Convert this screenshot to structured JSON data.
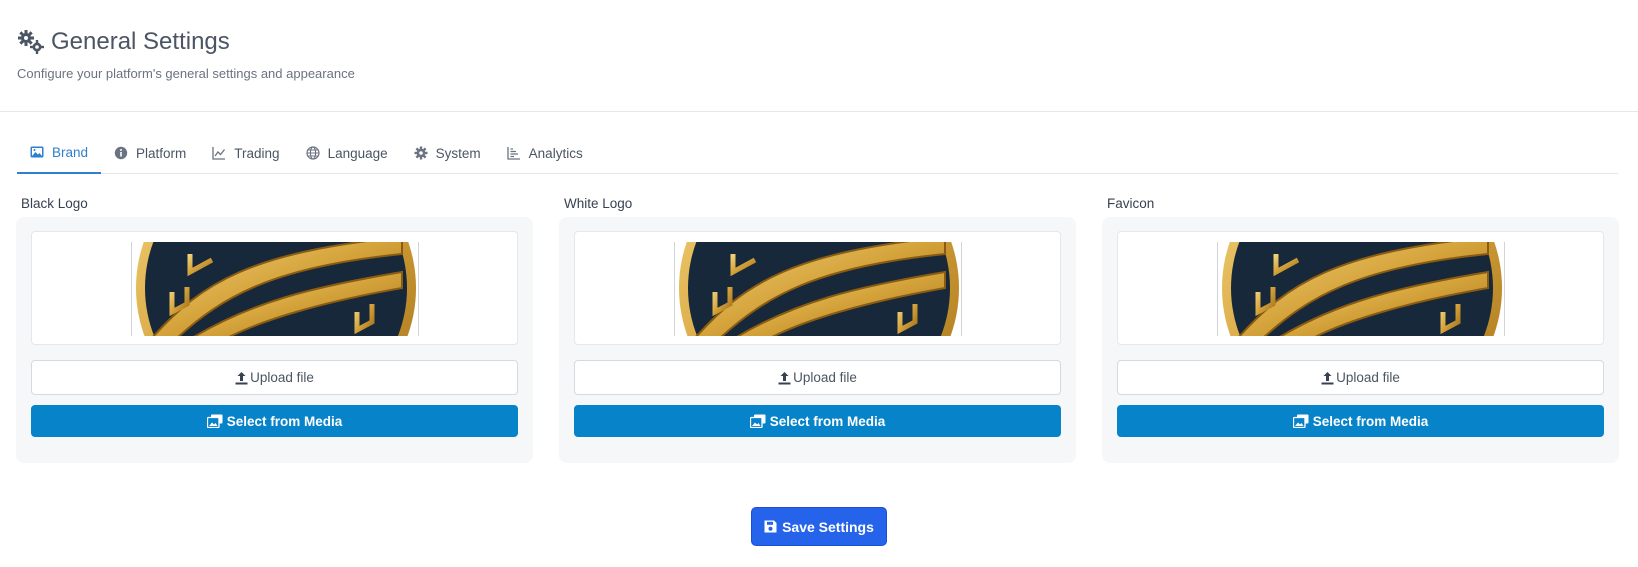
{
  "header": {
    "title": "General Settings",
    "subtitle": "Configure your platform's general settings and appearance",
    "icon": "gears-icon"
  },
  "tabs": [
    {
      "label": "Brand",
      "icon": "image-icon",
      "active": true
    },
    {
      "label": "Platform",
      "icon": "info-icon",
      "active": false
    },
    {
      "label": "Trading",
      "icon": "line-chart-icon",
      "active": false
    },
    {
      "label": "Language",
      "icon": "globe-icon",
      "active": false
    },
    {
      "label": "System",
      "icon": "gear-icon",
      "active": false
    },
    {
      "label": "Analytics",
      "icon": "bar-chart-icon",
      "active": false
    }
  ],
  "cards": [
    {
      "label": "Black Logo",
      "upload_label": "Upload file",
      "media_label": "Select from Media"
    },
    {
      "label": "White Logo",
      "upload_label": "Upload file",
      "media_label": "Select from Media"
    },
    {
      "label": "Favicon",
      "upload_label": "Upload file",
      "media_label": "Select from Media"
    }
  ],
  "save_label": "Save Settings",
  "colors": {
    "accent": "#2f7fcc",
    "media_button": "#0784c9",
    "save_button": "#2563eb",
    "logo_gold": "#d4a23a",
    "logo_navy": "#16283a"
  }
}
